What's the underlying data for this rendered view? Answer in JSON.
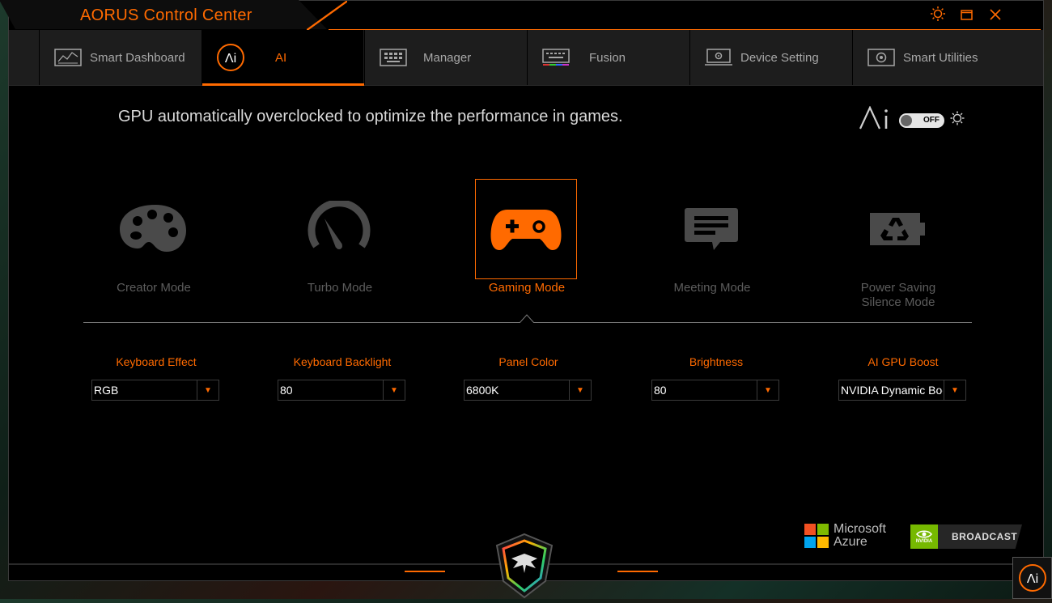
{
  "app": {
    "title": "AORUS Control Center"
  },
  "tabs": [
    {
      "label": "Smart Dashboard",
      "icon": "dashboard-icon"
    },
    {
      "label": "AI",
      "icon": "ai-icon",
      "active": true
    },
    {
      "label": "Manager",
      "icon": "manager-icon"
    },
    {
      "label": "Fusion",
      "icon": "keyboard-rgb-icon"
    },
    {
      "label": "Device Setting",
      "icon": "monitor-gear-icon"
    },
    {
      "label": "Smart Utilities",
      "icon": "utilities-icon"
    }
  ],
  "main": {
    "description": "GPU automatically overclocked to optimize the performance in games.",
    "ai_toggle": {
      "state": "OFF"
    }
  },
  "modes": [
    {
      "label": "Creator Mode",
      "icon": "palette-icon"
    },
    {
      "label": "Turbo Mode",
      "icon": "speedometer-icon"
    },
    {
      "label": "Gaming Mode",
      "icon": "gamepad-icon",
      "selected": true
    },
    {
      "label": "Meeting Mode",
      "icon": "chat-bubble-icon"
    },
    {
      "label": "Power Saving Silence Mode",
      "icon": "recycle-battery-icon"
    }
  ],
  "settings": [
    {
      "label": "Keyboard Effect",
      "value": "RGB"
    },
    {
      "label": "Keyboard Backlight",
      "value": "80"
    },
    {
      "label": "Panel Color",
      "value": "6800K"
    },
    {
      "label": "Brightness",
      "value": "80"
    },
    {
      "label": "AI GPU Boost",
      "value": "NVIDIA Dynamic Boost"
    }
  ],
  "partners": {
    "azure": {
      "line1": "Microsoft",
      "line2": "Azure"
    },
    "nvidia": {
      "label": "BROADCAST",
      "badge": "NVIDIA"
    }
  },
  "colors": {
    "accent": "#ff6a00",
    "inactive": "#5c5c5c",
    "bg": "#000000"
  }
}
